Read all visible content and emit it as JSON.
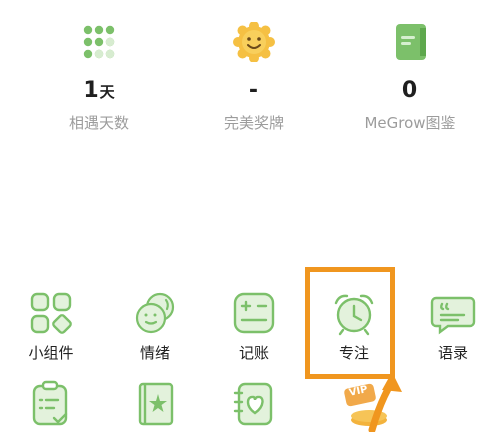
{
  "stats": [
    {
      "value": "1",
      "unit": "天",
      "label": "相遇天数",
      "icon": "dots-grid-icon"
    },
    {
      "value": "-",
      "unit": "",
      "label": "完美奖牌",
      "icon": "smiley-medal-icon"
    },
    {
      "value": "0",
      "unit": "",
      "label": "MeGrow图鉴",
      "icon": "book-icon"
    }
  ],
  "tools": [
    {
      "label": "小组件",
      "icon": "widgets-icon"
    },
    {
      "label": "情绪",
      "icon": "emotion-faces-icon"
    },
    {
      "label": "记账",
      "icon": "calculator-icon"
    },
    {
      "label": "专注",
      "icon": "alarm-clock-icon"
    },
    {
      "label": "语录",
      "icon": "quote-bubble-icon"
    }
  ],
  "tools_row2": [
    {
      "icon": "checklist-clipboard-icon"
    },
    {
      "icon": "star-book-icon"
    },
    {
      "icon": "heart-notebook-icon"
    },
    {
      "icon": "vip-coin-icon",
      "badge": "VIP"
    }
  ],
  "colors": {
    "accent_green": "#7cc06a",
    "light_green": "#e3f2dc",
    "highlight_orange": "#f0961f"
  }
}
